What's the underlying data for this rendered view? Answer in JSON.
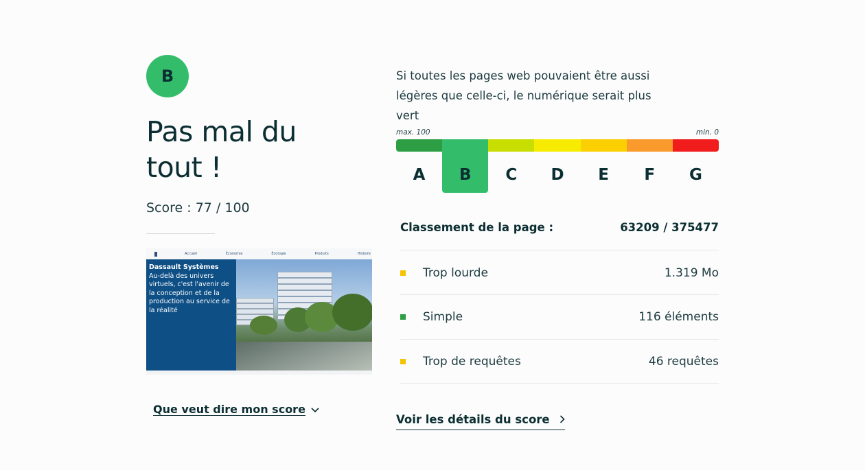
{
  "result": {
    "grade": "B",
    "headline": "Pas mal du tout !",
    "score_text": "Score : 77 / 100",
    "more_link": "Que veut dire mon score",
    "more_link_icon": "chevron-down-icon"
  },
  "thumbnail": {
    "nav_items": [
      "Accueil",
      "Économie",
      "Écologie",
      "Produits",
      "Histoire"
    ],
    "panel_title": "Dassault Systèmes",
    "panel_text": "Au-delà des univers virtuels, c'est l'avenir de la conception et de la production au service de la réalité"
  },
  "intro": "Si toutes les pages web pouvaient être aussi légères que celle-ci, le numérique serait plus vert",
  "scale": {
    "max_label": "max. 100",
    "min_label": "min. 0",
    "grades": [
      {
        "letter": "A",
        "color": "#2e9e45"
      },
      {
        "letter": "B",
        "color": "#33bd6b"
      },
      {
        "letter": "C",
        "color": "#c8dd00"
      },
      {
        "letter": "D",
        "color": "#f7ec00"
      },
      {
        "letter": "E",
        "color": "#fccf00"
      },
      {
        "letter": "F",
        "color": "#fb9a2c"
      },
      {
        "letter": "G",
        "color": "#f11c1c"
      }
    ],
    "active": "B"
  },
  "ranking": {
    "label": "Classement de la page :",
    "value": "63209 / 375477"
  },
  "metrics": [
    {
      "label": "Trop lourde",
      "value": "1.319 Mo",
      "color": "#f5c400"
    },
    {
      "label": "Simple",
      "value": "116 éléments",
      "color": "#2e9e45"
    },
    {
      "label": "Trop de requêtes",
      "value": "46 requêtes",
      "color": "#f5c400"
    }
  ],
  "details_link": "Voir les détails du score",
  "details_link_icon": "chevron-right-icon"
}
